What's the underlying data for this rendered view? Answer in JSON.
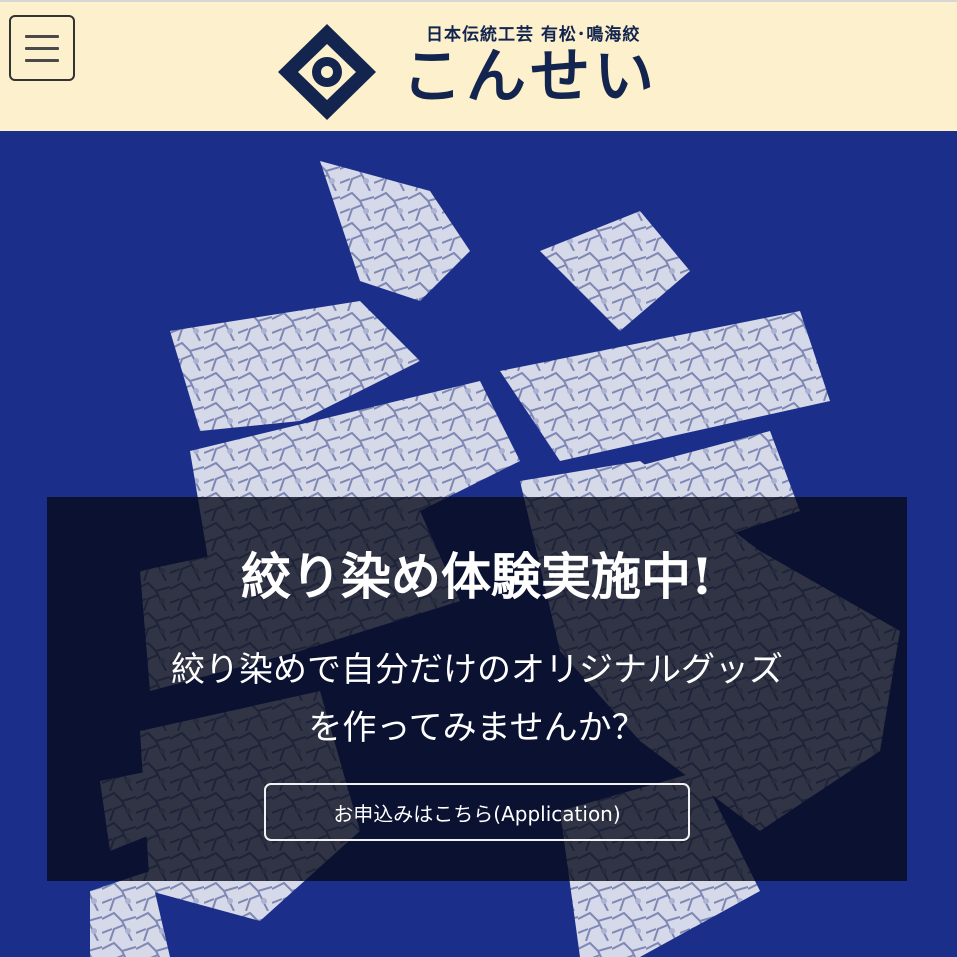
{
  "header": {
    "menu_button": {
      "icon": "hamburger-menu-icon"
    },
    "logo": {
      "tagline": "日本伝統工芸 有松･鳴海絞",
      "wordmark": "こんせい",
      "mark_icon": "kansei-crest-icon"
    }
  },
  "hero": {
    "background_art": "shibori-dyed-kanji-banner",
    "headline": "絞り染め体験実施中!",
    "subtext_line1": "絞り染めで自分だけのオリジナルグッズ",
    "subtext_line2": "を作ってみませんか？",
    "apply_button_label": "お申込みはこちら(Application)"
  },
  "colors": {
    "header_background": "#fdf0cd",
    "brand_navy": "#13254f",
    "indigo_background": "#1b2f8a",
    "overlay": "#060a1a"
  }
}
